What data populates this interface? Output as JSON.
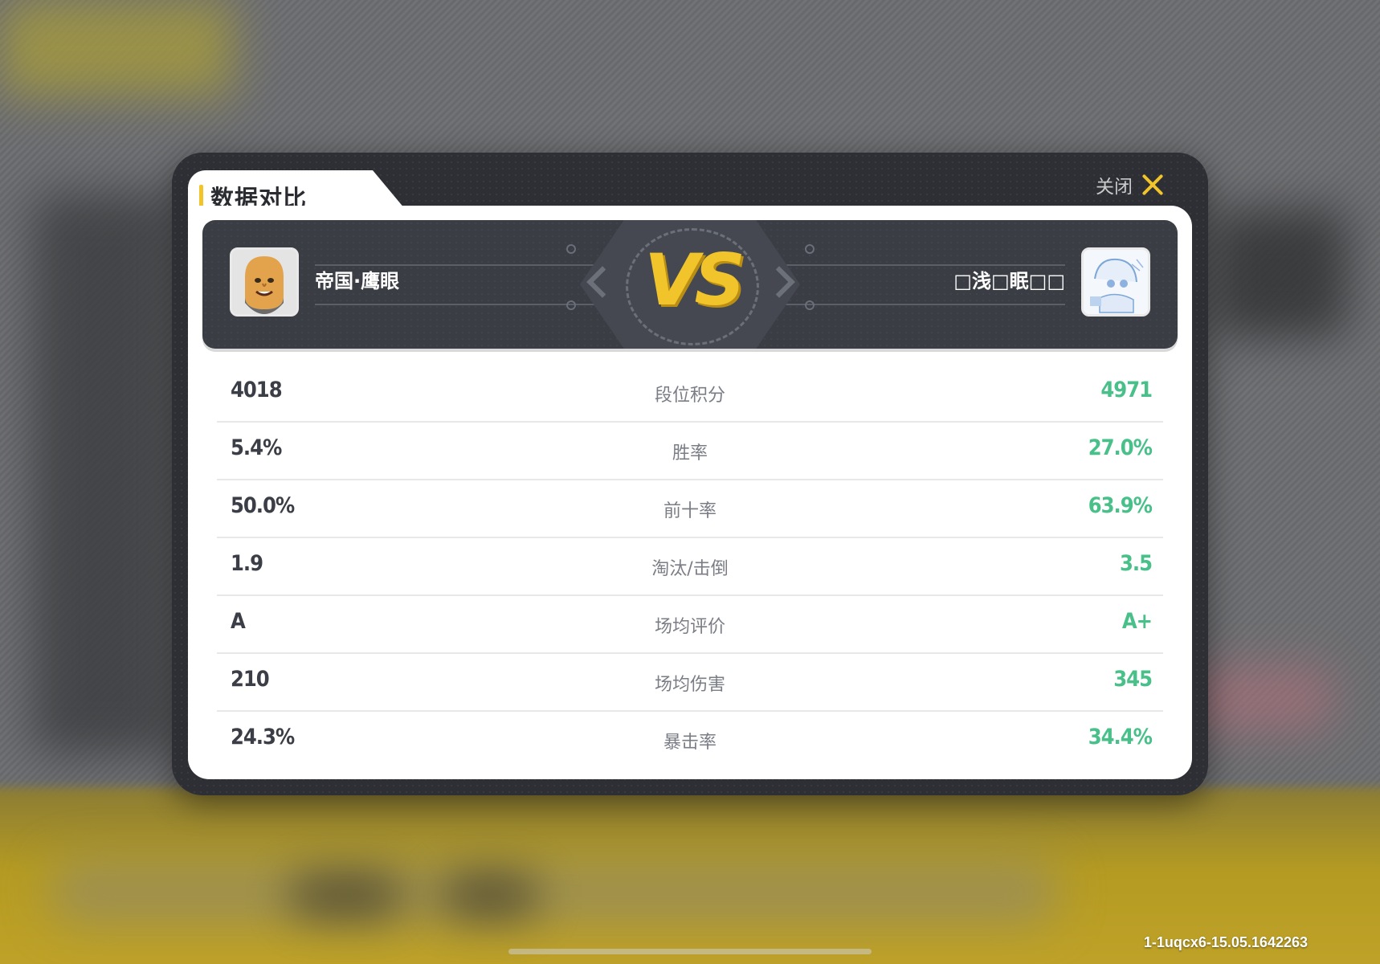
{
  "dialog": {
    "title": "数据对比",
    "close_label": "关闭"
  },
  "players": {
    "left": {
      "name": "帝国·鹰眼",
      "avatar": "bald-smiling-face-avatar"
    },
    "right": {
      "name": "□浅□眠□□",
      "avatar": "anime-girl-sketch-avatar"
    },
    "vs_label": "VS"
  },
  "stats": [
    {
      "label": "段位积分",
      "left": "4018",
      "right": "4971"
    },
    {
      "label": "胜率",
      "left": "5.4%",
      "right": "27.0%"
    },
    {
      "label": "前十率",
      "left": "50.0%",
      "right": "63.9%"
    },
    {
      "label": "淘汰/击倒",
      "left": "1.9",
      "right": "3.5"
    },
    {
      "label": "场均评价",
      "left": "A",
      "right": "A+"
    },
    {
      "label": "场均伤害",
      "left": "210",
      "right": "345"
    },
    {
      "label": "暴击率",
      "left": "24.3%",
      "right": "34.4%"
    }
  ],
  "build_id": "1-1uqcx6-15.05.1642263",
  "colors": {
    "accent_yellow": "#f2c42b",
    "right_value_green": "#49c089",
    "left_value_dark": "#3b3e46",
    "panel_dark": "#2d2f34"
  }
}
